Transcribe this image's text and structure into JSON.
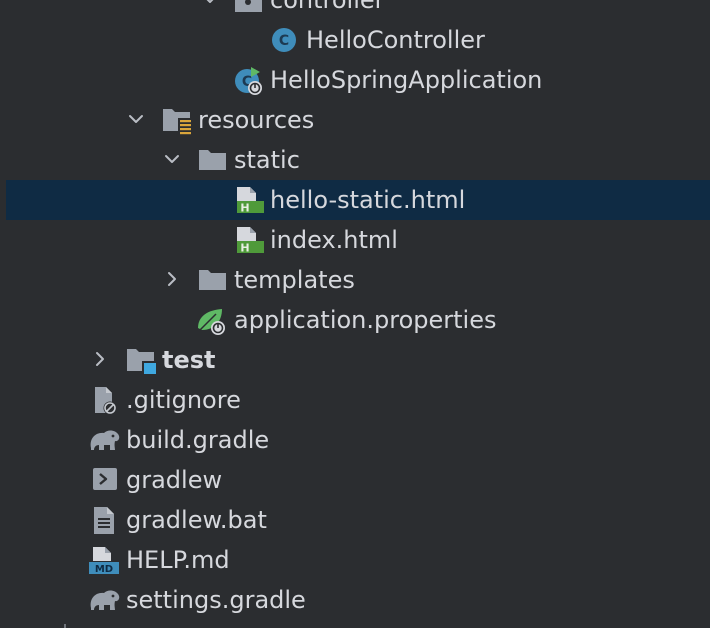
{
  "project_tree": {
    "items": [
      {
        "label": "controller",
        "icon": "package-folder-icon"
      },
      {
        "label": "HelloController",
        "icon": "java-class-icon"
      },
      {
        "label": "HelloSpringApplication",
        "icon": "spring-boot-application-icon"
      },
      {
        "label": "resources",
        "icon": "resources-folder-icon"
      },
      {
        "label": "static",
        "icon": "folder-icon"
      },
      {
        "label": "hello-static.html",
        "icon": "html-file-icon",
        "selected": true
      },
      {
        "label": "index.html",
        "icon": "html-file-icon"
      },
      {
        "label": "templates",
        "icon": "folder-icon"
      },
      {
        "label": "application.properties",
        "icon": "spring-properties-icon"
      },
      {
        "label": "test",
        "icon": "test-folder-icon"
      },
      {
        "label": ".gitignore",
        "icon": "ignored-file-icon"
      },
      {
        "label": "build.gradle",
        "icon": "gradle-elephant-icon"
      },
      {
        "label": "gradlew",
        "icon": "shell-script-icon"
      },
      {
        "label": "gradlew.bat",
        "icon": "text-file-icon"
      },
      {
        "label": "HELP.md",
        "icon": "markdown-file-icon"
      },
      {
        "label": "settings.gradle",
        "icon": "gradle-elephant-icon"
      }
    ]
  },
  "colors": {
    "background": "#2b2d30",
    "selection": "#0f2b44",
    "text": "#d6d8dd",
    "folder": "#9aa1ab",
    "java_class": "#3f8dbb",
    "spring_green": "#5fb865",
    "html_green": "#4f9a3a",
    "test_blue": "#3fa8e0"
  }
}
